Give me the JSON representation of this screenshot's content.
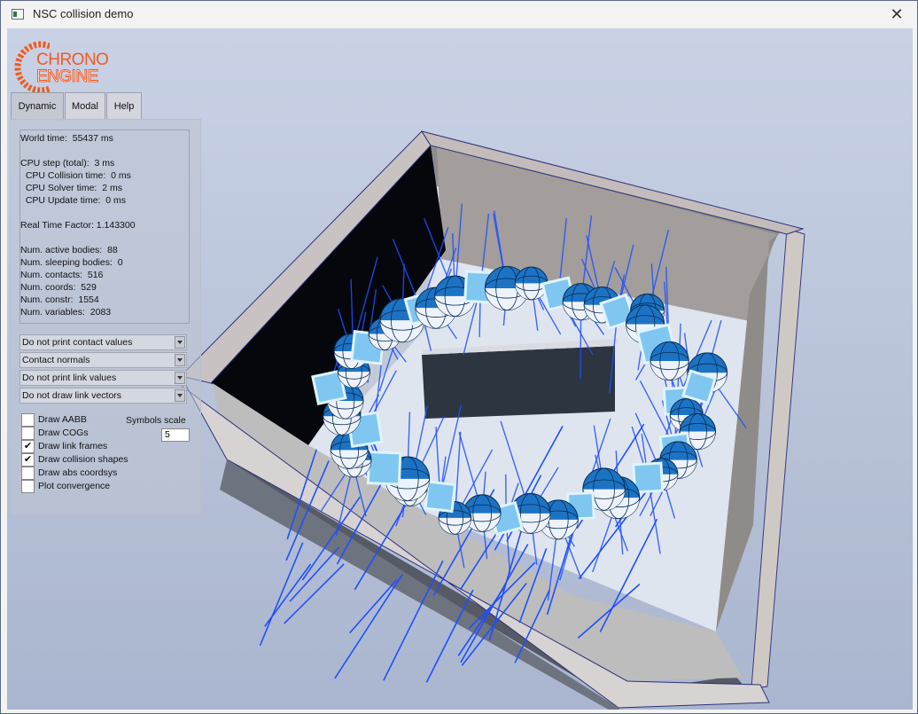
{
  "window": {
    "title": "NSC collision demo"
  },
  "logo": {
    "line1": "CHRONO",
    "line2": "ENGINE"
  },
  "tabs": [
    {
      "label": "Dynamic",
      "active": true
    },
    {
      "label": "Modal",
      "active": false
    },
    {
      "label": "Help",
      "active": false
    }
  ],
  "stats": {
    "world_time": "World time:  55437 ms",
    "cpu_step": "CPU step (total):  3 ms",
    "cpu_collision": "  CPU Collision time:  0 ms",
    "cpu_solver": "  CPU Solver time:  2 ms",
    "cpu_update": "  CPU Update time:  0 ms",
    "real_time_factor": "Real Time Factor: 1.143300",
    "active_bodies": "Num. active bodies:  88",
    "sleeping_bodies": "Num. sleeping bodies:  0",
    "contacts": "Num. contacts:  516",
    "coords": "Num. coords:  529",
    "constr": "Num. constr:  1554",
    "variables": "Num. variables:  2083"
  },
  "dropdowns": {
    "contact_values": "Do not print contact values",
    "contact_normals": "Contact normals",
    "link_values": "Do not print link values",
    "link_vectors": "Do not draw link vectors"
  },
  "checkboxes": [
    {
      "label": "Draw AABB",
      "checked": false
    },
    {
      "label": "Draw COGs",
      "checked": false
    },
    {
      "label": "Draw link frames",
      "checked": true
    },
    {
      "label": "Draw collision shapes",
      "checked": true
    },
    {
      "label": "Draw abs coordsys",
      "checked": false
    },
    {
      "label": "Plot convergence",
      "checked": false
    }
  ],
  "symbols_scale": {
    "label": "Symbols scale",
    "value": "5"
  },
  "colors": {
    "logo_orange": "#f05a22",
    "normals_blue": "#1f4fff",
    "ball_blue": "#1c73c4"
  }
}
